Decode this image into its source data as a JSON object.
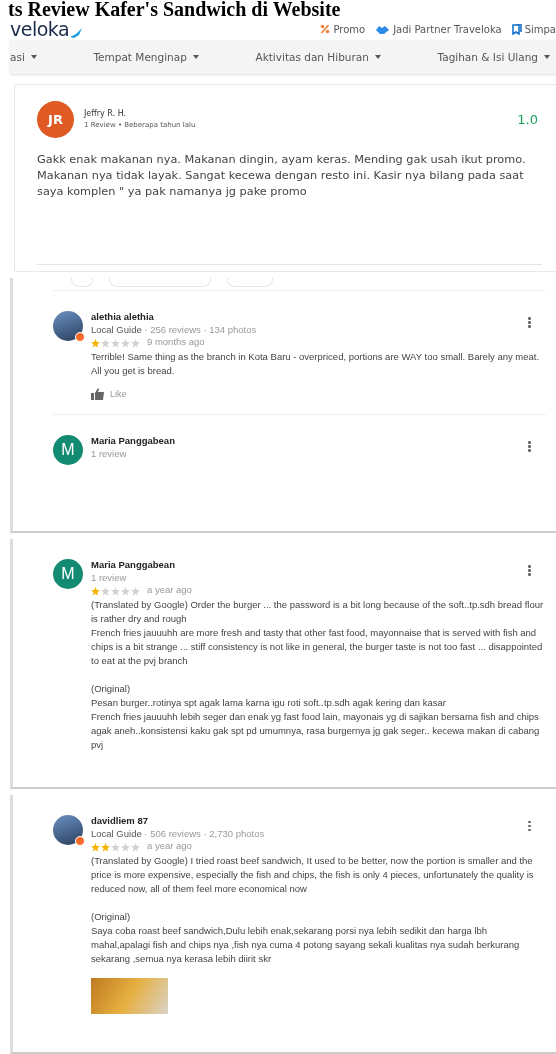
{
  "page_title": "ts Review Kafer's Sandwich di Website",
  "header": {
    "logo": "veloka",
    "links": [
      {
        "kind": "promo",
        "label": "Promo"
      },
      {
        "kind": "partner",
        "label": "Jadi Partner Traveloka"
      },
      {
        "kind": "saved",
        "label": "Simpa"
      }
    ]
  },
  "nav": [
    {
      "label": "asi"
    },
    {
      "label": "Tempat Menginap"
    },
    {
      "label": "Aktivitas dan Hiburan"
    },
    {
      "label": "Tagihan & Isi Ulang"
    }
  ],
  "traveloka_review": {
    "initials": "JR",
    "name": "Jeffry R. H.",
    "meta": "1 Review • Beberapa tahun lalu",
    "score": "1.0",
    "text": "Gakk enak makanan nya. Makanan dingin, ayam keras. Mending gak usah ikut promo. Makanan nya tidak layak. Sangat kecewa dengan resto ini. Kasir nya bilang pada saat saya komplen \" ya pak namanya jg pake promo"
  },
  "google_panels": [
    {
      "chips": true,
      "reviews": [
        {
          "avatar": {
            "kind": "photo"
          },
          "name": "alethia alethia",
          "guide": "Local Guide",
          "counts": "· 256 reviews · 134 photos",
          "stars": 1,
          "time": "9 months ago",
          "text": [
            "Terrible! Same thing as the branch in Kota Baru - overpriced, portions are WAY too small. Barely any meat. All you get is bread."
          ],
          "like": "Like"
        },
        {
          "avatar": {
            "kind": "initial",
            "initial": "M",
            "color": "#138a72"
          },
          "name": "Maria Panggabean",
          "counts": "1 review"
        }
      ]
    },
    {
      "chips": false,
      "reviews": [
        {
          "avatar": {
            "kind": "initial",
            "initial": "M",
            "color": "#138a72"
          },
          "name": "Maria Panggabean",
          "counts": "1 review",
          "stars": 1,
          "time": "a year ago",
          "text": [
            "(Translated by Google) Order the burger ... the password is a bit long because of the soft..tp.sdh bread flour is rather dry and rough",
            "French fries jauuuhh are more fresh and tasty that other fast food, mayonnaise that is served with fish and chips is a bit strange ... stiff consistency is not like in general, the burger taste is not too fast ... disappointed to eat at the pvj branch"
          ],
          "original": [
            "(Original)",
            "Pesan burger..rotinya spt agak lama karna igu roti soft..tp.sdh agak kering dan kasar",
            "French fries jauuuhh lebih seger dan enak yg fast food lain, mayonais yg di sajikan bersama fish and chips agak aneh..konsistensi kaku gak spt pd umumnya, rasa burgernya jg gak seger.. kecewa makan di cabang pvj"
          ]
        }
      ]
    },
    {
      "chips": false,
      "reviews": [
        {
          "avatar": {
            "kind": "photo"
          },
          "name": "davidliem 87",
          "guide": "Local Guide",
          "counts": "· 506 reviews · 2,730 photos",
          "stars": 2,
          "time": "a year ago",
          "text": [
            "(Translated by Google) I tried roast beef sandwich, It used to be better, now the portion is smaller and the price is more expensive, especially the fish and chips, the fish is only 4 pieces, unfortunately the quality is reduced now, all of them feel more economical now"
          ],
          "original": [
            "(Original)",
            "Saya coba roast beef sandwich,Dulu lebih enak,sekarang porsi nya lebih sedikit dan harga lbh mahal,apalagi fish and chips nya ,fish nya cuma 4 potong  sayang sekali kualitas nya sudah berkurang sekarang ,semua nya kerasa lebih diirit skr"
          ],
          "photo": true
        }
      ]
    }
  ]
}
